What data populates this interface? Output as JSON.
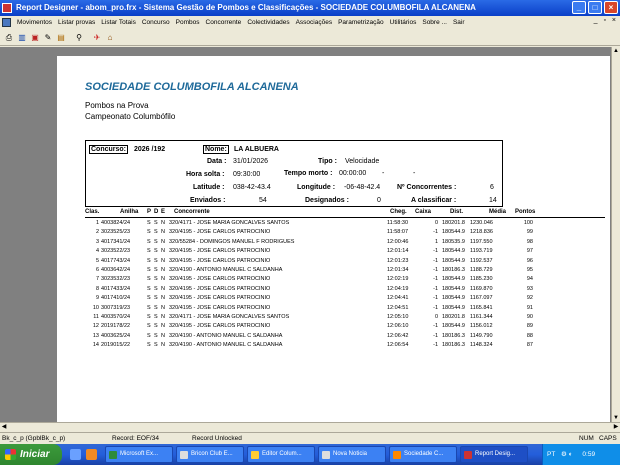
{
  "window": {
    "title": "Report Designer - abom_pro.frx - Sistema Gestão de Pombos e Classificações - SOCIEDADE COLUMBOFILA ALCANENA"
  },
  "menu": [
    "Movimentos",
    "Listar provas",
    "Listar Totais",
    "Concurso",
    "Pombos",
    "Concorrente",
    "Colectividades",
    "Associações",
    "Parametrização",
    "Utilitários",
    "Sobre ...",
    "Sair"
  ],
  "report": {
    "title": "SOCIEDADE COLUMBOFILA ALCANENA",
    "subtitle1": "Pombos na Prova",
    "subtitle2": "Campeonato Columbófilo",
    "concurso_label": "Concurso:",
    "concurso_value": "2026 /192",
    "nome_label": "Nome:",
    "nome_value": "LA ALBUERA",
    "data_label": "Data :",
    "data_value": "31/01/2026",
    "tipo_label": "Tipo :",
    "tipo_value": "Velocidade",
    "hora_label": "Hora solta :",
    "hora_value": "09:30:00",
    "tempo_label": "Tempo morto :",
    "tempo_value": "00:00:00",
    "tempo_dash1": "-",
    "tempo_dash2": "-",
    "lat_label": "Latitude :",
    "lat_value": "038-42-43.4",
    "lon_label": "Longitude :",
    "lon_value": "-06-48-42.4",
    "nconc_label": "Nº Concorrentes :",
    "nconc_value": "6",
    "env_label": "Enviados :",
    "env_value": "54",
    "desig_label": "Designados :",
    "desig_value": "0",
    "aclass_label": "A classificar :",
    "aclass_value": "14"
  },
  "table": {
    "headers": {
      "clas": "Clas.",
      "anilha": "Anilha",
      "p": "P",
      "d": "D",
      "e": "E",
      "conc": "Concorrente",
      "cheg": "Cheg.",
      "caixa": "Caixa",
      "dist": "Dist.",
      "media": "Média",
      "pontos": "Pontos"
    },
    "rows": [
      {
        "clas": "1",
        "anilha": "4003824/24",
        "p": "S",
        "d": "S",
        "e": "N",
        "conc": "320/4171 - JOSE MARIA GONCALVES SANTOS",
        "cheg": "11:58:30",
        "caixa": "0",
        "dist": "180201.8",
        "media": "1230.046",
        "pontos": "100"
      },
      {
        "clas": "2",
        "anilha": "3023525/23",
        "p": "S",
        "d": "S",
        "e": "N",
        "conc": "320/4195 - JOSE CARLOS PATROCINIO",
        "cheg": "11:58:07",
        "caixa": "-1",
        "dist": "180544.9",
        "media": "1218.836",
        "pontos": "99"
      },
      {
        "clas": "3",
        "anilha": "4017341/24",
        "p": "S",
        "d": "S",
        "e": "N",
        "conc": "320/55284 - DOMINGOS MANUEL F RODRIGUES",
        "cheg": "12:00:46",
        "caixa": "1",
        "dist": "180535.9",
        "media": "1197.550",
        "pontos": "98"
      },
      {
        "clas": "4",
        "anilha": "3023522/23",
        "p": "S",
        "d": "S",
        "e": "N",
        "conc": "320/4195 - JOSE CARLOS PATROCINIO",
        "cheg": "12:01:14",
        "caixa": "-1",
        "dist": "180544.9",
        "media": "1193.719",
        "pontos": "97"
      },
      {
        "clas": "5",
        "anilha": "4017743/24",
        "p": "S",
        "d": "S",
        "e": "N",
        "conc": "320/4195 - JOSE CARLOS PATROCINIO",
        "cheg": "12:01:23",
        "caixa": "-1",
        "dist": "180544.9",
        "media": "1192.537",
        "pontos": "96"
      },
      {
        "clas": "6",
        "anilha": "4003642/24",
        "p": "S",
        "d": "S",
        "e": "N",
        "conc": "320/4190 - ANTONIO MANUEL C SALDANHA",
        "cheg": "12:01:34",
        "caixa": "-1",
        "dist": "180186.3",
        "media": "1188.729",
        "pontos": "95"
      },
      {
        "clas": "7",
        "anilha": "3023532/23",
        "p": "S",
        "d": "S",
        "e": "N",
        "conc": "320/4195 - JOSE CARLOS PATROCINIO",
        "cheg": "12:02:19",
        "caixa": "-1",
        "dist": "180544.9",
        "media": "1185.230",
        "pontos": "94"
      },
      {
        "clas": "8",
        "anilha": "4017433/24",
        "p": "S",
        "d": "S",
        "e": "N",
        "conc": "320/4195 - JOSE CARLOS PATROCINIO",
        "cheg": "12:04:19",
        "caixa": "-1",
        "dist": "180544.9",
        "media": "1169.870",
        "pontos": "93"
      },
      {
        "clas": "9",
        "anilha": "4017410/24",
        "p": "S",
        "d": "S",
        "e": "N",
        "conc": "320/4195 - JOSE CARLOS PATROCINIO",
        "cheg": "12:04:41",
        "caixa": "-1",
        "dist": "180544.9",
        "media": "1167.097",
        "pontos": "92"
      },
      {
        "clas": "10",
        "anilha": "3007319/23",
        "p": "S",
        "d": "S",
        "e": "N",
        "conc": "320/4195 - JOSE CARLOS PATROCINIO",
        "cheg": "12:04:51",
        "caixa": "-1",
        "dist": "180544.9",
        "media": "1165.841",
        "pontos": "91"
      },
      {
        "clas": "11",
        "anilha": "4003570/24",
        "p": "S",
        "d": "S",
        "e": "N",
        "conc": "320/4171 - JOSE MARIA GONCALVES SANTOS",
        "cheg": "12:05:10",
        "caixa": "0",
        "dist": "180201.8",
        "media": "1161.344",
        "pontos": "90"
      },
      {
        "clas": "12",
        "anilha": "2019178/22",
        "p": "S",
        "d": "S",
        "e": "N",
        "conc": "320/4195 - JOSE CARLOS PATROCINIO",
        "cheg": "12:06:10",
        "caixa": "-1",
        "dist": "180544.9",
        "media": "1156.012",
        "pontos": "89"
      },
      {
        "clas": "13",
        "anilha": "4003625/24",
        "p": "S",
        "d": "S",
        "e": "N",
        "conc": "320/4190 - ANTONIO MANUEL C SALDANHA",
        "cheg": "12:06:42",
        "caixa": "-1",
        "dist": "180186.3",
        "media": "1149.790",
        "pontos": "88"
      },
      {
        "clas": "14",
        "anilha": "2019015/22",
        "p": "S",
        "d": "S",
        "e": "N",
        "conc": "320/4190 - ANTONIO MANUEL C SALDANHA",
        "cheg": "12:06:54",
        "caixa": "-1",
        "dist": "180186.3",
        "media": "1148.324",
        "pontos": "87"
      }
    ]
  },
  "status": {
    "left": "Bk_c_p (GpblBk_c_p)",
    "record": "Record: EOF/34",
    "locked": "Record Unlocked",
    "num": "NUM",
    "caps": "CAPS"
  },
  "taskbar": {
    "start": "Iniciar",
    "tasks": [
      "Microsoft Ex...",
      "Bricon Club E...",
      "Editor Colum...",
      "Nova Noticia",
      "Sociedade C...",
      "Report Desig..."
    ],
    "lang": "PT",
    "clock": "0:59"
  }
}
